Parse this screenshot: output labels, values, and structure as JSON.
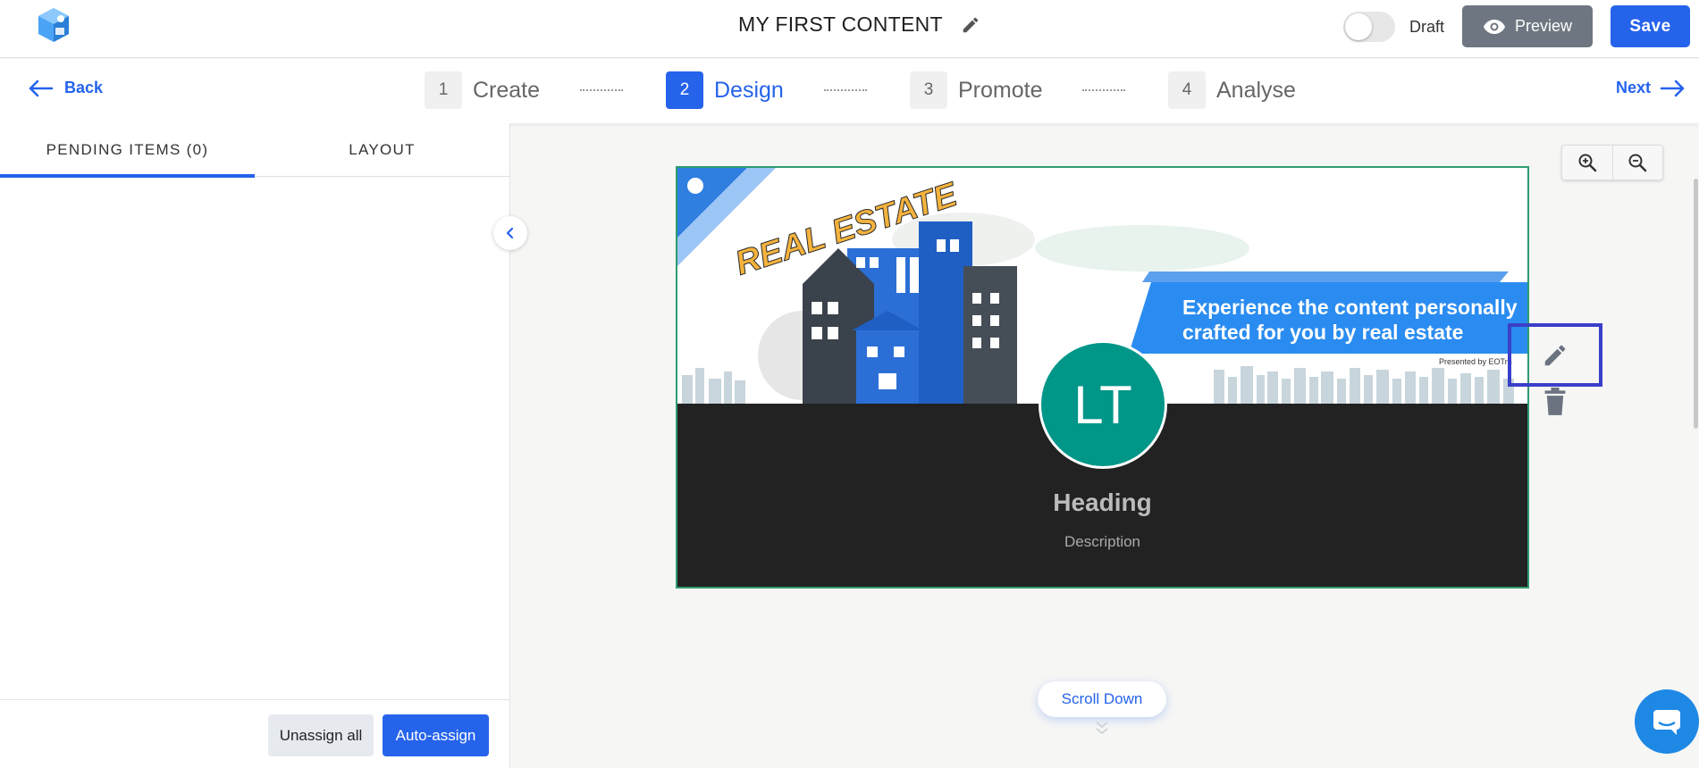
{
  "header": {
    "title": "MY FIRST CONTENT",
    "draft_label": "Draft",
    "preview_label": "Preview",
    "save_label": "Save"
  },
  "steps": {
    "back_label": "Back",
    "next_label": "Next",
    "items": [
      {
        "num": "1",
        "label": "Create"
      },
      {
        "num": "2",
        "label": "Design"
      },
      {
        "num": "3",
        "label": "Promote"
      },
      {
        "num": "4",
        "label": "Analyse"
      }
    ],
    "active": "Design"
  },
  "sidebar": {
    "tabs": [
      {
        "label": "PENDING ITEMS (0)"
      },
      {
        "label": "LAYOUT"
      }
    ],
    "unassign_label": "Unassign all",
    "autoassign_label": "Auto-assign"
  },
  "card": {
    "banner_title": "REAL ESTATE",
    "banner_line1": "Experience the content personally",
    "banner_line2": "crafted for you by real estate",
    "presented_by": "Presented by EOTrn",
    "avatar_initials": "LT",
    "heading": "Heading",
    "description": "Description"
  },
  "canvas": {
    "scroll_down_label": "Scroll Down"
  },
  "colors": {
    "accent": "#2563eb",
    "avatar": "#009688",
    "card_border": "#2e9c6e",
    "highlight": "#3a3fc9"
  },
  "icons": [
    "logo-icon",
    "pencil-icon",
    "eye-icon",
    "arrow-left-icon",
    "arrow-right-icon",
    "chevron-left-icon",
    "zoom-in-icon",
    "zoom-out-icon",
    "trash-icon",
    "chevron-down-icon",
    "chat-icon"
  ]
}
